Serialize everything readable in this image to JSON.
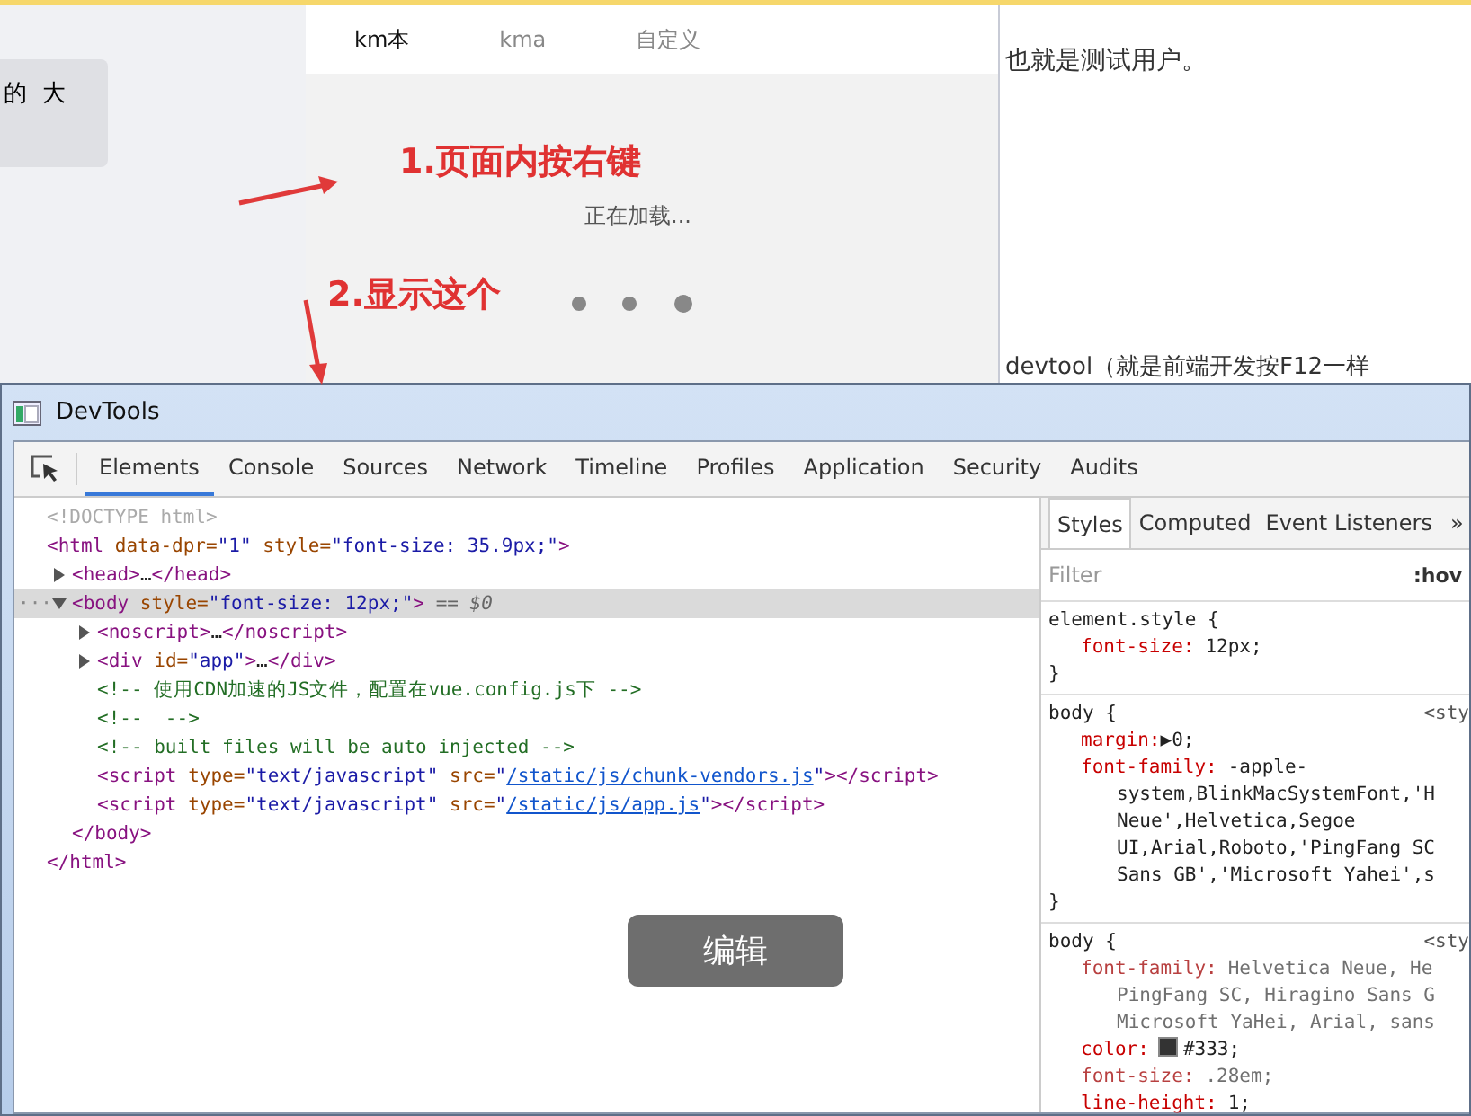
{
  "background_page": {
    "left_card": {
      "text": "的  大"
    },
    "preview": {
      "tabs": [
        {
          "label": "km本",
          "selected": true
        },
        {
          "label": "kma",
          "selected": false
        },
        {
          "label": "自定义",
          "selected": false
        }
      ],
      "loading_text": "正在加载..."
    },
    "right_texts": [
      "也就是测试用户。",
      "devtool（就是前端开发按F12一样"
    ],
    "annotations": [
      "1.页面内按右键",
      "2.显示这个"
    ]
  },
  "devtools": {
    "title": "DevTools",
    "tabs": [
      {
        "label": "Elements",
        "selected": true
      },
      {
        "label": "Console",
        "selected": false
      },
      {
        "label": "Sources",
        "selected": false
      },
      {
        "label": "Network",
        "selected": false
      },
      {
        "label": "Timeline",
        "selected": false
      },
      {
        "label": "Profiles",
        "selected": false
      },
      {
        "label": "Application",
        "selected": false
      },
      {
        "label": "Security",
        "selected": false
      },
      {
        "label": "Audits",
        "selected": false
      }
    ],
    "dom_tree": [
      {
        "selected": false,
        "parts": [
          {
            "kind": "doctype",
            "text": "<!DOCTYPE html>"
          }
        ]
      },
      {
        "selected": false,
        "parts": [
          {
            "kind": "tag",
            "text": "<html"
          },
          {
            "kind": "attr",
            "text": " data-dpr="
          },
          {
            "kind": "value",
            "text": "\"1\""
          },
          {
            "kind": "attr",
            "text": " style="
          },
          {
            "kind": "value",
            "text": "\"font-size: 35.9px;\""
          },
          {
            "kind": "tag",
            "text": ">"
          }
        ],
        "closing": [
          {
            "kind": "tag",
            "text": "</html>"
          }
        ],
        "children": [
          {
            "selected": false,
            "expanded": false,
            "parts": [
              {
                "kind": "tag",
                "text": "<head>"
              },
              {
                "kind": "plain",
                "text": "…"
              },
              {
                "kind": "tag",
                "text": "</head>"
              }
            ]
          },
          {
            "selected": true,
            "expanded": true,
            "gutter_mark": "···",
            "parts": [
              {
                "kind": "tag",
                "text": "<body"
              },
              {
                "kind": "attr",
                "text": " style="
              },
              {
                "kind": "value",
                "text": "\"font-size: 12px;\""
              },
              {
                "kind": "tag",
                "text": ">"
              },
              {
                "kind": "marker",
                "text": " == $0"
              }
            ],
            "closing": [
              {
                "kind": "tag",
                "text": "</body>"
              }
            ],
            "children": [
              {
                "selected": false,
                "expanded": false,
                "parts": [
                  {
                    "kind": "tag",
                    "text": "<noscript>"
                  },
                  {
                    "kind": "plain",
                    "text": "…"
                  },
                  {
                    "kind": "tag",
                    "text": "</noscript>"
                  }
                ]
              },
              {
                "selected": false,
                "expanded": false,
                "parts": [
                  {
                    "kind": "tag",
                    "text": "<div"
                  },
                  {
                    "kind": "attr",
                    "text": " id="
                  },
                  {
                    "kind": "value",
                    "text": "\"app\""
                  },
                  {
                    "kind": "tag",
                    "text": ">"
                  },
                  {
                    "kind": "plain",
                    "text": "…"
                  },
                  {
                    "kind": "tag",
                    "text": "</div>"
                  }
                ]
              },
              {
                "selected": false,
                "parts": [
                  {
                    "kind": "comment",
                    "text": "<!-- 使用CDN加速的JS文件，配置在vue.config.js下 -->"
                  }
                ]
              },
              {
                "selected": false,
                "parts": [
                  {
                    "kind": "comment",
                    "text": "<!--  -->"
                  }
                ]
              },
              {
                "selected": false,
                "parts": [
                  {
                    "kind": "comment",
                    "text": "<!-- built files will be auto injected -->"
                  }
                ]
              },
              {
                "selected": false,
                "parts": [
                  {
                    "kind": "tag",
                    "text": "<script"
                  },
                  {
                    "kind": "attr",
                    "text": " type="
                  },
                  {
                    "kind": "value",
                    "text": "\"text/javascript\""
                  },
                  {
                    "kind": "attr",
                    "text": " src="
                  },
                  {
                    "kind": "value",
                    "text": "\""
                  },
                  {
                    "kind": "link",
                    "text": "/static/js/chunk-vendors.js"
                  },
                  {
                    "kind": "value",
                    "text": "\""
                  },
                  {
                    "kind": "tag",
                    "text": "></script>"
                  }
                ]
              },
              {
                "selected": false,
                "parts": [
                  {
                    "kind": "tag",
                    "text": "<script"
                  },
                  {
                    "kind": "attr",
                    "text": " type="
                  },
                  {
                    "kind": "value",
                    "text": "\"text/javascript\""
                  },
                  {
                    "kind": "attr",
                    "text": " src="
                  },
                  {
                    "kind": "value",
                    "text": "\""
                  },
                  {
                    "kind": "link",
                    "text": "/static/js/app.js"
                  },
                  {
                    "kind": "value",
                    "text": "\""
                  },
                  {
                    "kind": "tag",
                    "text": "></script>"
                  }
                ]
              }
            ]
          }
        ]
      }
    ],
    "styles_pane": {
      "tabs": [
        {
          "label": "Styles",
          "selected": true
        },
        {
          "label": "Computed",
          "selected": false
        },
        {
          "label": "Event Listeners",
          "selected": false
        }
      ],
      "more": "»",
      "filter": {
        "placeholder": "Filter"
      },
      "hov": ":hov",
      "rules": [
        {
          "selector": "element.style {",
          "declarations": [
            {
              "name": "font-size:",
              "value": "12px;",
              "overridden": false
            }
          ],
          "close": "}"
        },
        {
          "selector": "body {",
          "source": "<sty",
          "declarations": [
            {
              "name": "margin:",
              "value": "▶0;",
              "overridden": false
            },
            {
              "name": "font-family:",
              "value": "-apple-",
              "overridden": false,
              "continuation": [
                "system,BlinkMacSystemFont,'H",
                "Neue',Helvetica,Segoe",
                "UI,Arial,Roboto,'PingFang SC",
                "Sans GB','Microsoft Yahei',s"
              ]
            }
          ],
          "close": "}"
        },
        {
          "selector": "body {",
          "source": "<sty",
          "declarations": [
            {
              "name": "font-family:",
              "value": "Helvetica Neue, He",
              "overridden": true,
              "continuation": [
                "PingFang SC, Hiragino Sans G",
                "Microsoft YaHei, Arial, sans"
              ]
            },
            {
              "name": "color:",
              "value": "#333;",
              "overridden": false,
              "color": "#333333"
            },
            {
              "name": "font-size:",
              "value": ".28em;",
              "overridden": true
            },
            {
              "name": "line-height:",
              "value": "1;",
              "overridden": false
            }
          ]
        }
      ]
    }
  },
  "edit_button": "编辑"
}
